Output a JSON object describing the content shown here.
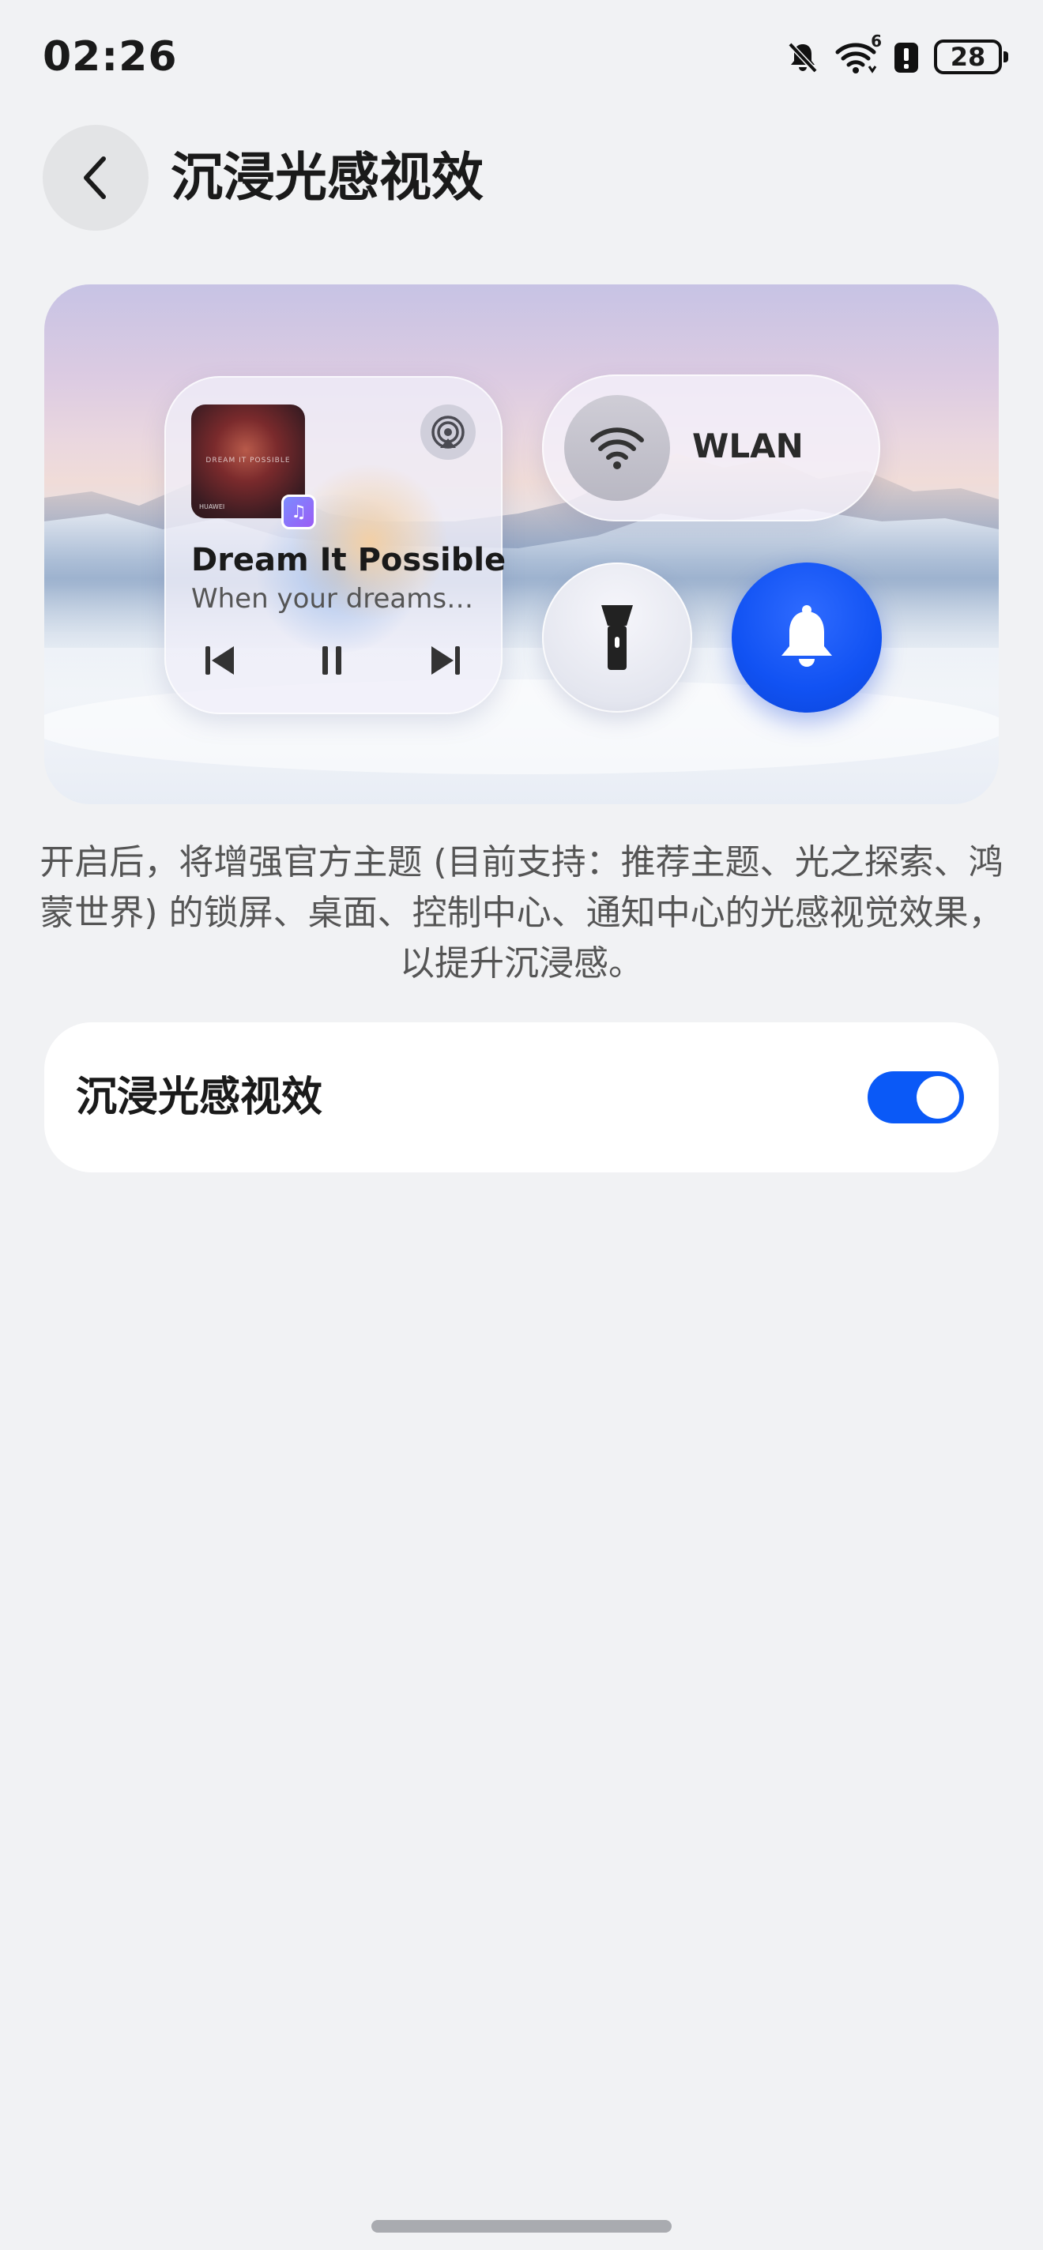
{
  "status_bar": {
    "time": "02:26",
    "icons": [
      "bell-muted-icon",
      "wifi-6-icon",
      "alert-icon",
      "battery-icon"
    ],
    "battery_level": "28",
    "wifi_badge": "6"
  },
  "header": {
    "back_icon": "chevron-left-icon",
    "title": "沉浸光感视效"
  },
  "preview": {
    "music": {
      "album_text": "DREAM IT POSSIBLE",
      "album_brand": "HUAWEI",
      "song_title": "Dream It Possible",
      "song_subtitle": "When your dreams…",
      "controls": [
        "previous-icon",
        "pause-icon",
        "next-icon"
      ],
      "cast_icon": "cast-icon",
      "app_icon": "♫"
    },
    "wlan_label": "WLAN",
    "flashlight_icon": "flashlight-icon",
    "bell_icon": "bell-icon",
    "accent": "#0a59f7"
  },
  "description": "开启后，将增强官方主题 (目前支持：推荐主题、光之探索、鸿蒙世界) 的锁屏、桌面、控制中心、通知中心的光感视觉效果，以提升沉浸感。",
  "setting": {
    "label": "沉浸光感视效",
    "enabled": true
  },
  "colors": {
    "background": "#f1f2f4",
    "toggle_on": "#0a59f7"
  }
}
